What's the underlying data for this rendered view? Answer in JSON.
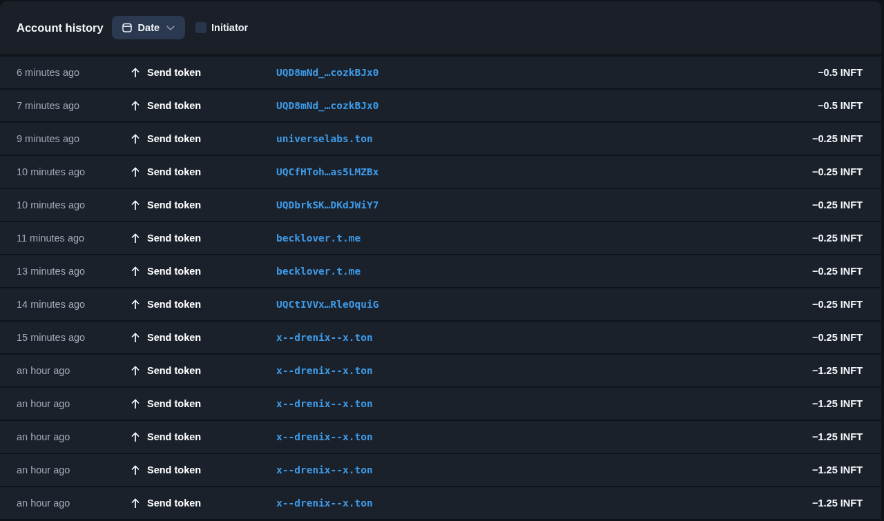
{
  "header": {
    "title": "Account history",
    "date_filter": {
      "label": "Date"
    },
    "initiator_filter": {
      "label": "Initiator",
      "checked": false
    }
  },
  "rows": [
    {
      "time": "6 minutes ago",
      "action": "Send token",
      "counterparty": "UQD8mNd_…cozkBJx0",
      "amount": "−0.5 INFT"
    },
    {
      "time": "7 minutes ago",
      "action": "Send token",
      "counterparty": "UQD8mNd_…cozkBJx0",
      "amount": "−0.5 INFT"
    },
    {
      "time": "9 minutes ago",
      "action": "Send token",
      "counterparty": "universelabs.ton",
      "amount": "−0.25 INFT"
    },
    {
      "time": "10 minutes ago",
      "action": "Send token",
      "counterparty": "UQCfHToh…as5LMZBx",
      "amount": "−0.25 INFT"
    },
    {
      "time": "10 minutes ago",
      "action": "Send token",
      "counterparty": "UQDbrkSK…DKdJWiY7",
      "amount": "−0.25 INFT"
    },
    {
      "time": "11 minutes ago",
      "action": "Send token",
      "counterparty": "becklover.t.me",
      "amount": "−0.25 INFT"
    },
    {
      "time": "13 minutes ago",
      "action": "Send token",
      "counterparty": "becklover.t.me",
      "amount": "−0.25 INFT"
    },
    {
      "time": "14 minutes ago",
      "action": "Send token",
      "counterparty": "UQCtIVVx…RleOquiG",
      "amount": "−0.25 INFT"
    },
    {
      "time": "15 minutes ago",
      "action": "Send token",
      "counterparty": "x--drenix--x.ton",
      "amount": "−0.25 INFT"
    },
    {
      "time": "an hour ago",
      "action": "Send token",
      "counterparty": "x--drenix--x.ton",
      "amount": "−1.25 INFT"
    },
    {
      "time": "an hour ago",
      "action": "Send token",
      "counterparty": "x--drenix--x.ton",
      "amount": "−1.25 INFT"
    },
    {
      "time": "an hour ago",
      "action": "Send token",
      "counterparty": "x--drenix--x.ton",
      "amount": "−1.25 INFT"
    },
    {
      "time": "an hour ago",
      "action": "Send token",
      "counterparty": "x--drenix--x.ton",
      "amount": "−1.25 INFT"
    },
    {
      "time": "an hour ago",
      "action": "Send token",
      "counterparty": "x--drenix--x.ton",
      "amount": "−1.25 INFT"
    }
  ]
}
